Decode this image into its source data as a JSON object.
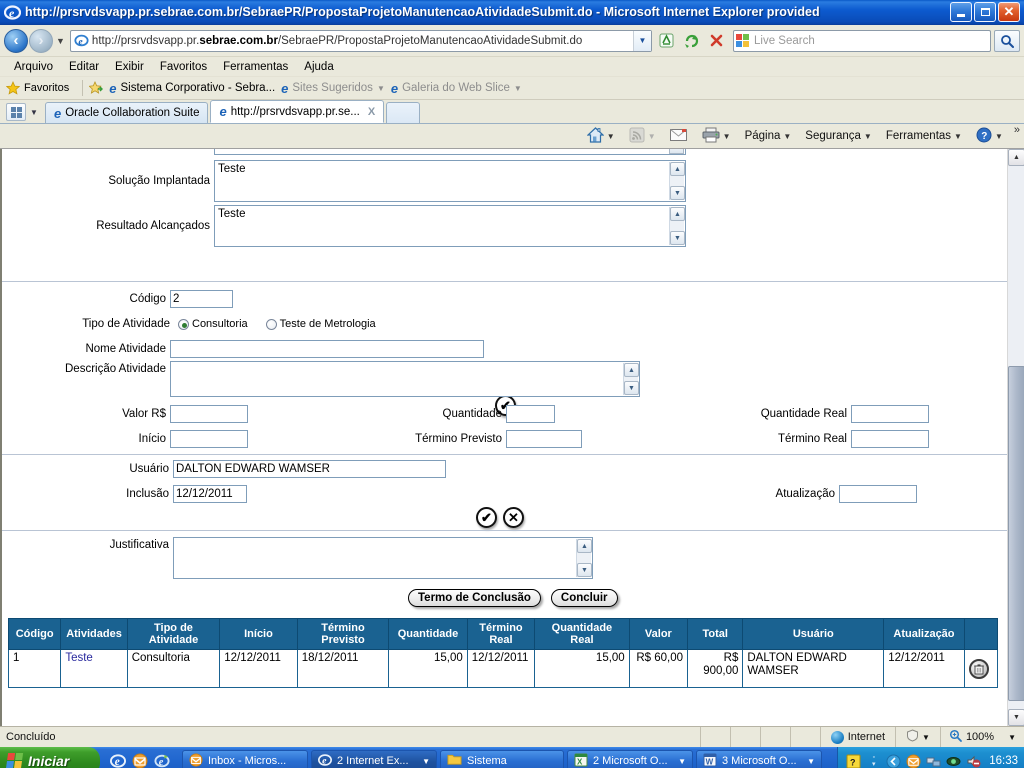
{
  "window": {
    "title": "http://prsrvdsvapp.pr.sebrae.com.br/SebraePR/PropostaProjetoManutencaoAtividadeSubmit.do - Microsoft Internet Explorer provided",
    "minimize_label": "Minimizar",
    "restore_label": "Restaurar",
    "close_label": "Fechar"
  },
  "address_bar": {
    "url_prefix": "http://prsrvdsvapp.pr.",
    "url_domain": "sebrae.com.br",
    "url_suffix": "/SebraePR/PropostaProjetoManutencaoAtividadeSubmit.do",
    "url_full": "http://prsrvdsvapp.pr.sebrae.com.br/SebraePR/PropostaProjetoManutencaoAtividadeSubmit.do",
    "search_placeholder": "Live Search",
    "back_label": "Voltar",
    "forward_label": "Avançar",
    "stop_label": "X",
    "refresh_label": "↻",
    "compat_label": "Modo de Exibição de Compatibilidade"
  },
  "menu": {
    "items": [
      "Arquivo",
      "Editar",
      "Exibir",
      "Favoritos",
      "Ferramentas",
      "Ajuda"
    ]
  },
  "favorites_bar": {
    "label": "Favoritos",
    "items": [
      {
        "label": "Sistema Corporativo - Sebra...",
        "dimmed": false,
        "caret": false
      },
      {
        "label": "Sites Sugeridos",
        "dimmed": true,
        "caret": true
      },
      {
        "label": "Galeria do Web Slice",
        "dimmed": true,
        "caret": true
      }
    ]
  },
  "tabs": [
    {
      "label": "Oracle Collaboration Suite",
      "active": false
    },
    {
      "label": "http://prsrvdsvapp.pr.se...",
      "active": true,
      "close": "X"
    }
  ],
  "command_bar": {
    "items": [
      {
        "label": "",
        "icon": "home-icon",
        "caret": true
      },
      {
        "label": "",
        "icon": "rss-icon",
        "caret": true,
        "dim": true
      },
      {
        "label": "",
        "icon": "mail-icon",
        "caret": false
      },
      {
        "label": "",
        "icon": "printer-icon",
        "caret": true
      },
      {
        "label": "Página",
        "icon": "",
        "caret": true
      },
      {
        "label": "Segurança",
        "icon": "",
        "caret": true
      },
      {
        "label": "Ferramentas",
        "icon": "",
        "caret": true
      },
      {
        "label": "",
        "icon": "help-icon",
        "caret": true
      }
    ],
    "overflow": "»"
  },
  "form": {
    "solucao_label": "Solução Implantada",
    "solucao_value": "Teste",
    "resultado_label": "Resultado Alcançados",
    "resultado_value": "Teste",
    "codigo_label": "Código",
    "codigo_value": "2",
    "tipo_atividade_label": "Tipo de Atividade",
    "tipo_opt1": "Consultoria",
    "tipo_opt2": "Teste de Metrologia",
    "nome_atividade_label": "Nome Atividade",
    "nome_atividade_value": "",
    "descricao_label": "Descrição Atividade",
    "descricao_value": "",
    "valor_label": "Valor R$",
    "valor_value": "",
    "quantidade_label": "Quantidade",
    "quantidade_value": "",
    "quantidade_real_label": "Quantidade Real",
    "quantidade_real_value": "",
    "inicio_label": "Início",
    "inicio_value": "",
    "termino_previsto_label": "Término Previsto",
    "termino_previsto_value": "",
    "termino_real_label": "Término Real",
    "termino_real_value": "",
    "usuario_label": "Usuário",
    "usuario_value": "DALTON EDWARD WAMSER",
    "inclusao_label": "Inclusão",
    "inclusao_value": "12/12/2011",
    "atualizacao_label": "Atualização",
    "atualizacao_value": "",
    "justificativa_label": "Justificativa",
    "justificativa_value": "",
    "confirm_icon": "✔",
    "cancel_icon": "✕",
    "btn_termo": "Termo de Conclusão",
    "btn_concluir": "Concluir"
  },
  "table": {
    "headers": [
      "Código",
      "Atividades",
      "Tipo de Atividade",
      "Início",
      "Término Previsto",
      "Quantidade",
      "Término Real",
      "Quantidade Real",
      "Valor",
      "Total",
      "Usuário",
      "Atualização",
      ""
    ],
    "rows": [
      {
        "codigo": "1",
        "atividades": "Teste",
        "tipo": "Consultoria",
        "inicio": "12/12/2011",
        "termino_previsto": "18/12/2011",
        "quantidade": "15,00",
        "termino_real": "12/12/2011",
        "quantidade_real": "15,00",
        "valor": "R$ 60,00",
        "total": "R$ 900,00",
        "usuario": "DALTON EDWARD WAMSER",
        "atualizacao": "12/12/2011",
        "action_icon": "trash-icon"
      }
    ]
  },
  "status_bar": {
    "text": "Concluído",
    "zone": "Internet",
    "protected_mode": "",
    "zoom": "100%"
  },
  "taskbar": {
    "start_label": "Iniciar",
    "tasks": [
      {
        "label": "Inbox - Micros...",
        "icon": "outlook-icon",
        "active": false,
        "caret": false
      },
      {
        "label": "2 Internet Ex...",
        "icon": "ie-icon",
        "active": true,
        "caret": true
      },
      {
        "label": "Sistema",
        "icon": "folder-icon",
        "active": false,
        "caret": false
      },
      {
        "label": "2 Microsoft O...",
        "icon": "excel-icon",
        "active": false,
        "caret": true
      },
      {
        "label": "3 Microsoft O...",
        "icon": "word-icon",
        "active": false,
        "caret": true
      }
    ],
    "clock": "16:33"
  },
  "colors": {
    "titlebar_blue": "#0d5bd0",
    "table_header_blue": "#1a6291",
    "field_border": "#7f9db9",
    "chrome_bg": "#eae9dc",
    "taskbar_blue": "#2167cf",
    "start_green": "#2e8a1e"
  }
}
